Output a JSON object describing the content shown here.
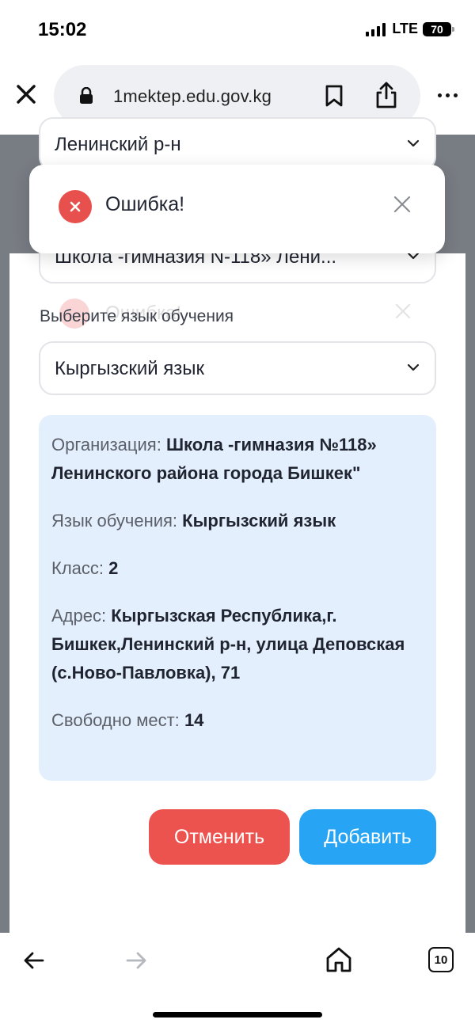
{
  "status": {
    "time": "15:02",
    "network": "LTE",
    "battery": "70"
  },
  "browser": {
    "url": "1mektep.edu.gov.kg",
    "tab_count": "10"
  },
  "form": {
    "district_value": "Ленинский р-н",
    "school_value": "Школа -гимназия N-118» Лени...",
    "language_label": "Выберите язык обучения",
    "language_value": "Кыргызский язык"
  },
  "toast": {
    "message": "Ошибка!",
    "ghost_message": "Ошибка!"
  },
  "info": {
    "org_label": "Организация:",
    "org_value": "Школа -гимназия №118» Ленинского района города Бишкек\"",
    "lang_label": "Язык обучения:",
    "lang_value": "Кыргызский язык",
    "class_label": "Класс:",
    "class_value": "2",
    "address_label": "Адрес:",
    "address_value": "Кыргызская Республика,г. Бишкек,Ленинский р-н, улица Деповская (с.Ново-Павловка), 71",
    "seats_label": "Свободно мест:",
    "seats_value": "14"
  },
  "actions": {
    "cancel": "Отменить",
    "add": "Добавить"
  },
  "colors": {
    "error": "#e8504d",
    "cancel": "#ec524e",
    "add": "#27a4f3",
    "info_bg": "#e4effd",
    "overlay": "#787c83"
  }
}
